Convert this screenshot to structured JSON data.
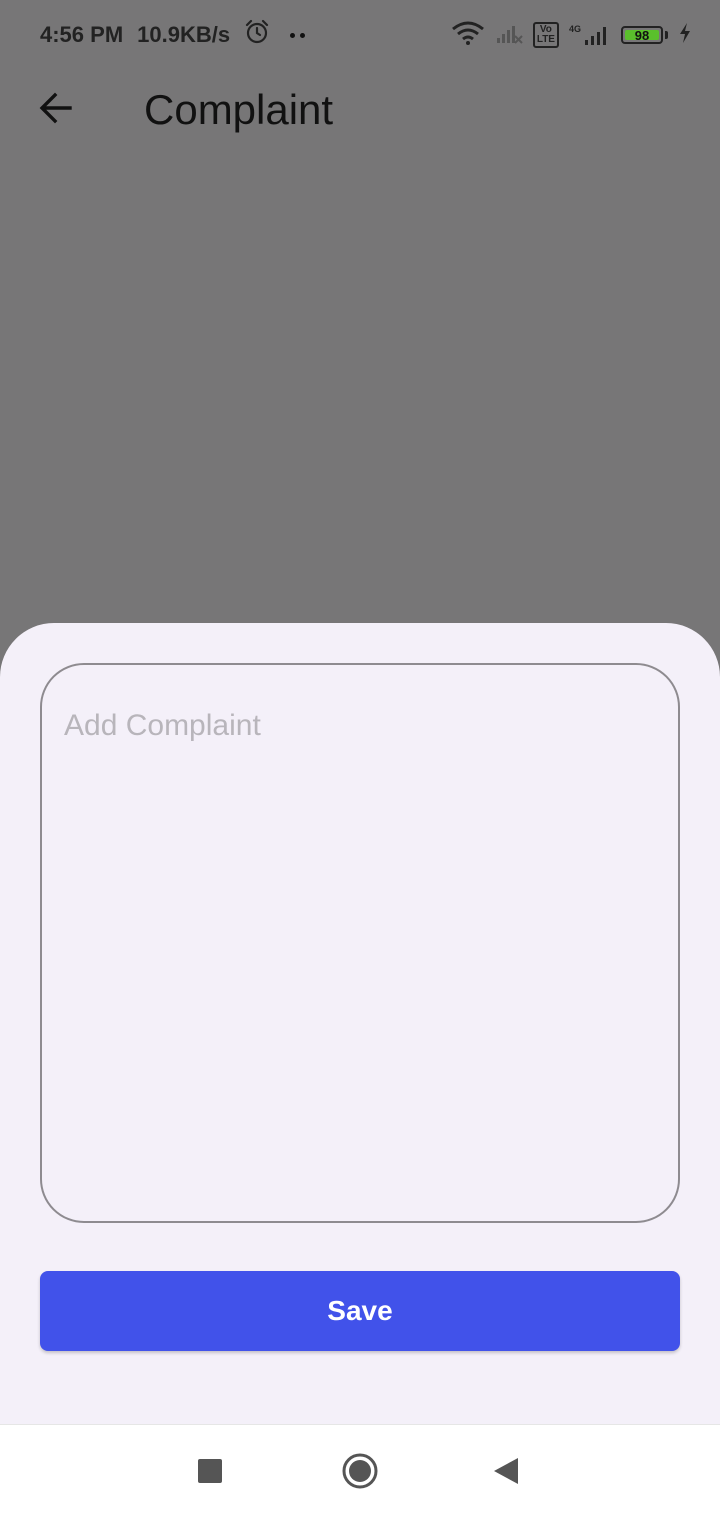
{
  "status_bar": {
    "time": "4:56 PM",
    "net_speed": "10.9KB/s",
    "battery_level": "98",
    "icons": [
      "alarm-icon",
      "wifi-icon",
      "signal-off-icon",
      "volte-icon",
      "signal-4g-icon",
      "battery-icon",
      "charging-icon"
    ],
    "volte_label": "Vo\nLTE",
    "network_label": "4G",
    "battery_color": "#5ac02c"
  },
  "app_bar": {
    "title": "Complaint",
    "back_icon": "arrow-left-icon"
  },
  "sheet": {
    "complaint_placeholder": "Add Complaint",
    "complaint_value": "",
    "save_label": "Save",
    "accent_color": "#4152ea"
  },
  "nav_bar": {
    "icons": [
      "recent-apps-icon",
      "home-icon",
      "back-icon"
    ]
  }
}
